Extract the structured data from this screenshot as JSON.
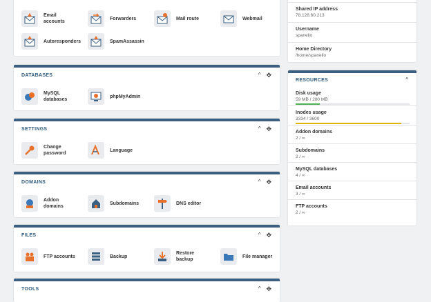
{
  "email": {
    "items": [
      {
        "label": "Email accounts",
        "icon": "email-accounts-icon"
      },
      {
        "label": "Forwarders",
        "icon": "forwarders-icon"
      },
      {
        "label": "Mail route",
        "icon": "mail-route-icon"
      },
      {
        "label": "Webmail",
        "icon": "webmail-icon"
      },
      {
        "label": "Autoresponders",
        "icon": "autoresponders-icon"
      },
      {
        "label": "SpamAssassin",
        "icon": "spamassassin-icon"
      }
    ]
  },
  "databases": {
    "title": "DATABASES",
    "items": [
      {
        "label": "MySQL databases",
        "icon": "mysql-icon"
      },
      {
        "label": "phpMyAdmin",
        "icon": "phpmyadmin-icon"
      }
    ]
  },
  "settings": {
    "title": "SETTINGS",
    "items": [
      {
        "label": "Change password",
        "icon": "key-icon"
      },
      {
        "label": "Language",
        "icon": "language-icon"
      }
    ]
  },
  "domains": {
    "title": "DOMAINS",
    "items": [
      {
        "label": "Addon domains",
        "icon": "addon-domains-icon"
      },
      {
        "label": "Subdomains",
        "icon": "subdomains-icon"
      },
      {
        "label": "DNS editor",
        "icon": "dns-signpost-icon"
      }
    ]
  },
  "files": {
    "title": "FILES",
    "items": [
      {
        "label": "FTP accounts",
        "icon": "ftp-users-icon"
      },
      {
        "label": "Backup",
        "icon": "backup-icon"
      },
      {
        "label": "Restore backup",
        "icon": "restore-icon"
      },
      {
        "label": "File manager",
        "icon": "folder-icon"
      }
    ]
  },
  "tools": {
    "title": "TOOLS"
  },
  "info": {
    "shared_ip_label": "Shared IP address",
    "shared_ip": "78.128.60.213",
    "username_label": "Username",
    "username": "spanelio",
    "home_label": "Home Directory",
    "home": "/home/spanelio"
  },
  "resources": {
    "title": "RESOURCES",
    "disk_label": "Disk usage",
    "disk_value": "59 MB / 280 MB",
    "disk_fraction": 0.21,
    "disk_color": "#4caf50",
    "inodes_label": "Inodes usage",
    "inodes_value": "3334 / 3600",
    "inodes_fraction": 0.93,
    "inodes_color": "#e0b400",
    "addon_label": "Addon domains",
    "addon_value": "2 / ∞",
    "sub_label": "Subdomains",
    "sub_value": "2 / ∞",
    "mysql_label": "MySQL databases",
    "mysql_value": "4 / ∞",
    "email_label": "Email accounts",
    "email_value": "3 / ∞",
    "ftp_label": "FTP accounts",
    "ftp_value": "2 / ∞"
  }
}
